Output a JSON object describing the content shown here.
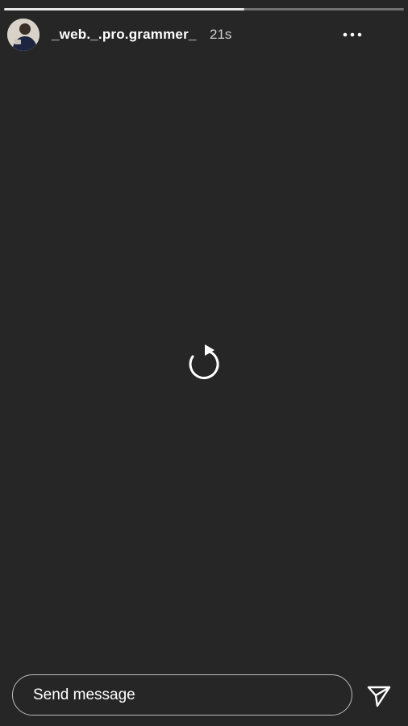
{
  "story": {
    "progress": 0.6
  },
  "header": {
    "username": "_web._.pro.grammer_",
    "timestamp": "21s",
    "avatar_icon": "user-avatar-icon",
    "more_icon": "more-horizontal-icon"
  },
  "center": {
    "replay_icon": "replay-icon"
  },
  "footer": {
    "message_placeholder": "Send message",
    "send_icon": "send-paper-plane-icon"
  },
  "colors": {
    "background": "#262626",
    "text": "#ffffff",
    "progress_fill": "#e6e6e6"
  }
}
